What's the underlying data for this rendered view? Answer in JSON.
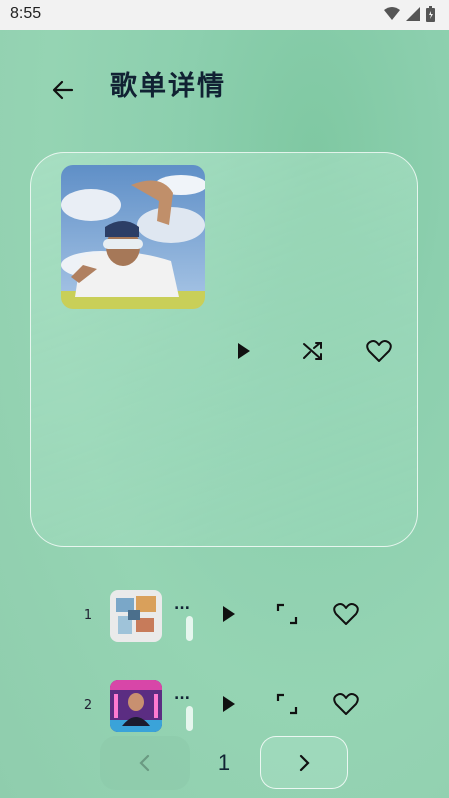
{
  "status_bar": {
    "time": "8:55"
  },
  "header": {
    "title": "歌单详情"
  },
  "playlist": {
    "current_page": "1"
  },
  "songs": [
    {
      "index": "1",
      "title": "..."
    },
    {
      "index": "2",
      "title": "..."
    }
  ],
  "icons": {
    "back": "arrow-left-icon",
    "play": "play-icon",
    "shuffle": "shuffle-icon",
    "favorite": "heart-icon",
    "fullscreen": "fullscreen-icon",
    "prev": "chevron-left-icon",
    "next": "chevron-right-icon"
  },
  "colors": {
    "accent": "#8fcdad",
    "text": "#123322"
  }
}
